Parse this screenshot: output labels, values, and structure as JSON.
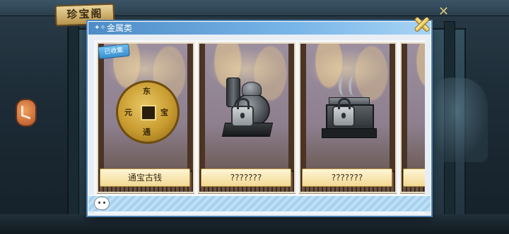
{
  "game": {
    "title": "珍宝阁"
  },
  "panel": {
    "title": "金属类",
    "header_icon": "sparkle-icon"
  },
  "cards": [
    {
      "name": "通宝古钱",
      "state": "owned",
      "badge": "已收集",
      "item_icon": "ancient-coin-icon",
      "coin_chars": [
        "东",
        "宝",
        "通",
        "元"
      ]
    },
    {
      "name": "???????",
      "state": "locked",
      "item_icon": "teapot-icon"
    },
    {
      "name": "???????",
      "state": "locked",
      "item_icon": "incense-burner-icon"
    },
    {
      "name": "",
      "state": "partial"
    }
  ],
  "colors": {
    "header": "#4d8cc6",
    "label_bg": "#f2d993",
    "badge": "#3a8fd0"
  }
}
